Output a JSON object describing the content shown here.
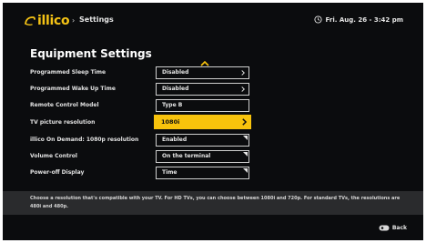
{
  "header": {
    "logo_text": "illico",
    "breadcrumb_separator": "›",
    "breadcrumb": "Settings",
    "datetime": "Fri. Aug. 26 - 3:42 pm",
    "brand_color": "#f5c315"
  },
  "page": {
    "title": "Equipment Settings"
  },
  "settings": [
    {
      "label": "Programmed Sleep Time",
      "value": "Disabled",
      "control": "chevron",
      "selected": false
    },
    {
      "label": "Programmed Wake Up Time",
      "value": "Disabled",
      "control": "chevron",
      "selected": false
    },
    {
      "label": "Remote Control Model",
      "value": "Type B",
      "control": "none",
      "selected": false
    },
    {
      "label": "TV picture resolution",
      "value": "1080i",
      "control": "chevron",
      "selected": true
    },
    {
      "label": "illico On Demand: 1080p resolution",
      "value": "Enabled",
      "control": "dropdown-corner",
      "selected": false
    },
    {
      "label": "Volume Control",
      "value": "On the terminal",
      "control": "dropdown-corner",
      "selected": false
    },
    {
      "label": "Power-off Display",
      "value": "Time",
      "control": "dropdown-corner",
      "selected": false
    }
  ],
  "help": {
    "text": "Choose a resolution that's compatible with your TV. For HD TVs, you can choose between 1080i and 720p. For standard TVs, the resolutions are 480i and 480p."
  },
  "footer": {
    "back_label": "Back"
  },
  "colors": {
    "background": "#0b0c0e",
    "highlight": "#f8c30c",
    "help_bar": "#2a2b2d"
  }
}
